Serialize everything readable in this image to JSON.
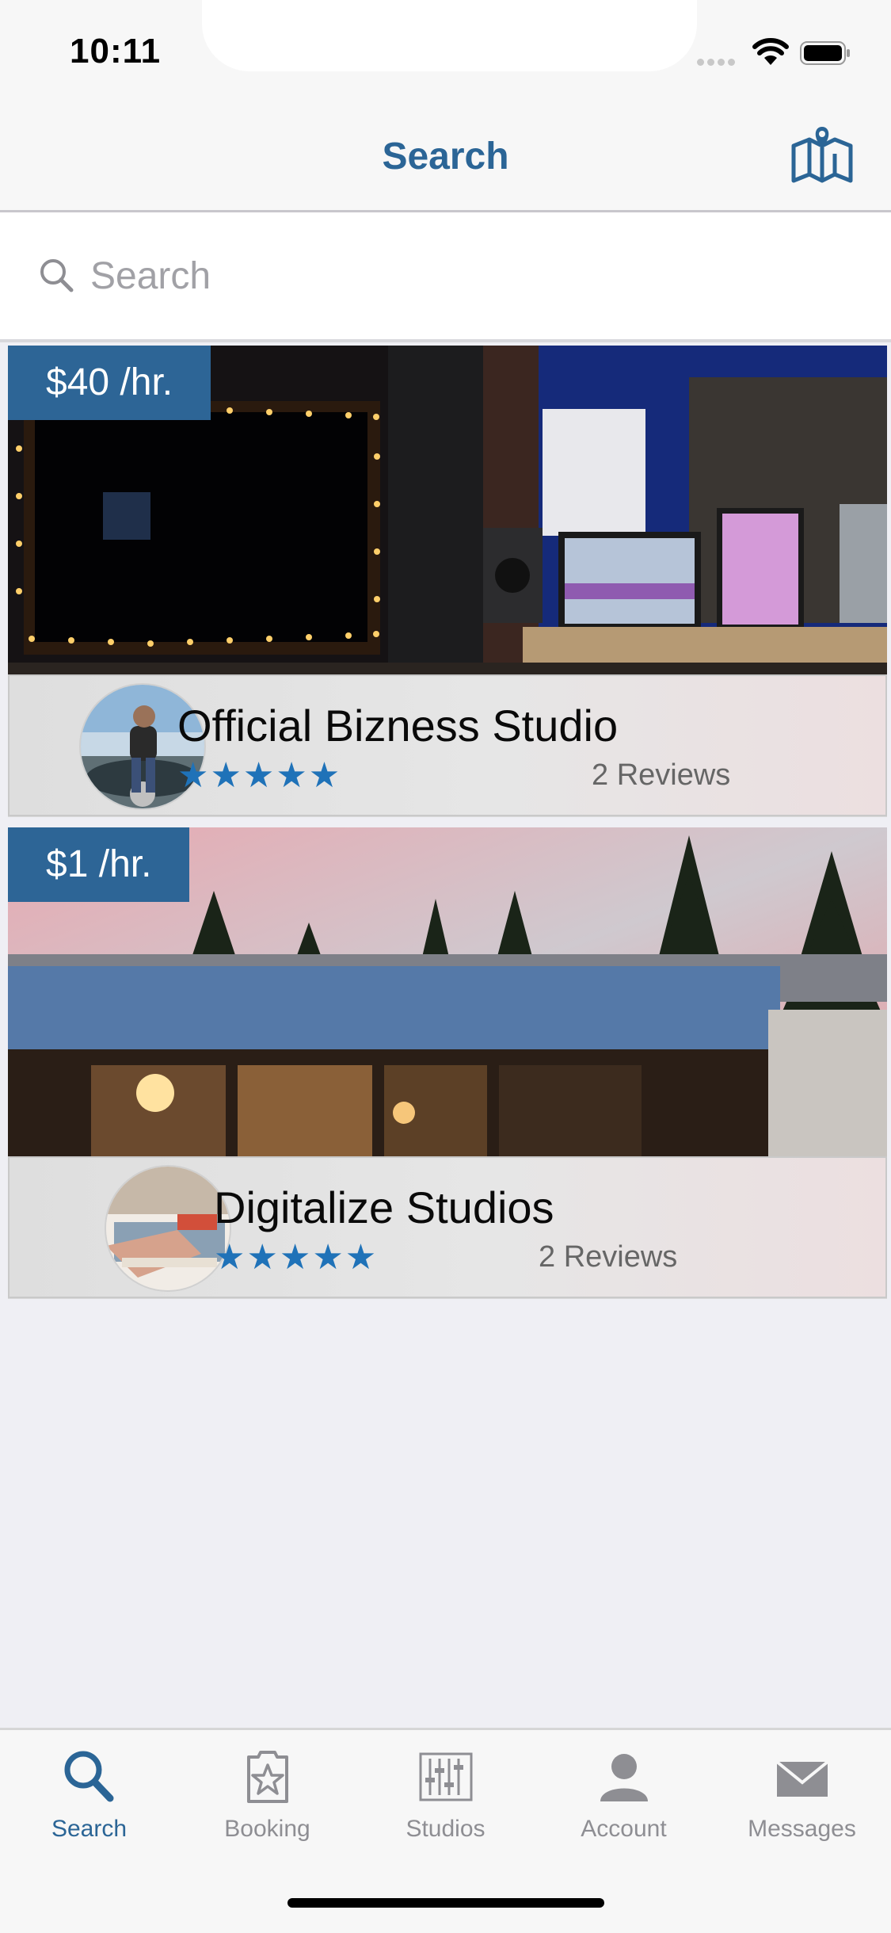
{
  "status_bar": {
    "time": "10:11"
  },
  "nav": {
    "title": "Search",
    "map_icon": "map-icon"
  },
  "search": {
    "placeholder": "Search",
    "value": ""
  },
  "studios": [
    {
      "price": "$40 /hr.",
      "name": "Official Bizness Studio",
      "rating": 5,
      "stars": "★★★★★",
      "reviews": "2 Reviews"
    },
    {
      "price": "$1 /hr.",
      "name": "Digitalize Studios",
      "rating": 5,
      "stars": "★★★★★",
      "reviews": "2 Reviews"
    }
  ],
  "tabs": [
    {
      "label": "Search",
      "icon": "search-icon",
      "active": true
    },
    {
      "label": "Booking",
      "icon": "booking-star-icon",
      "active": false
    },
    {
      "label": "Studios",
      "icon": "mixer-sliders-icon",
      "active": false
    },
    {
      "label": "Account",
      "icon": "person-icon",
      "active": false
    },
    {
      "label": "Messages",
      "icon": "envelope-icon",
      "active": false
    }
  ],
  "colors": {
    "accent": "#2b6596",
    "price_badge": "#2d6596",
    "stars": "#1f72b8",
    "tab_inactive": "#8e8e93"
  }
}
